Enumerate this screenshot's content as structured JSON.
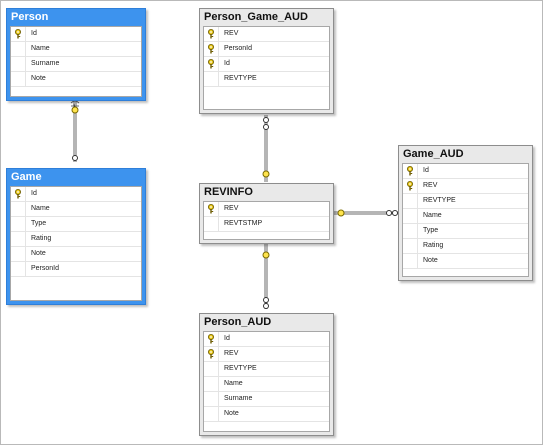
{
  "tables": {
    "person": {
      "title": "Person",
      "columns": [
        {
          "name": "Id",
          "key": true
        },
        {
          "name": "Name",
          "key": false
        },
        {
          "name": "Surname",
          "key": false
        },
        {
          "name": "Note",
          "key": false
        }
      ]
    },
    "game": {
      "title": "Game",
      "columns": [
        {
          "name": "Id",
          "key": true
        },
        {
          "name": "Name",
          "key": false
        },
        {
          "name": "Type",
          "key": false
        },
        {
          "name": "Rating",
          "key": false
        },
        {
          "name": "Note",
          "key": false
        },
        {
          "name": "PersonId",
          "key": false
        }
      ]
    },
    "person_game_aud": {
      "title": "Person_Game_AUD",
      "columns": [
        {
          "name": "REV",
          "key": true
        },
        {
          "name": "PersonId",
          "key": true
        },
        {
          "name": "Id",
          "key": true
        },
        {
          "name": "REVTYPE",
          "key": false
        }
      ]
    },
    "revinfo": {
      "title": "REVINFO",
      "columns": [
        {
          "name": "REV",
          "key": true
        },
        {
          "name": "REVTSTMP",
          "key": false
        }
      ]
    },
    "game_aud": {
      "title": "Game_AUD",
      "columns": [
        {
          "name": "Id",
          "key": true
        },
        {
          "name": "REV",
          "key": true
        },
        {
          "name": "REVTYPE",
          "key": false
        },
        {
          "name": "Name",
          "key": false
        },
        {
          "name": "Type",
          "key": false
        },
        {
          "name": "Rating",
          "key": false
        },
        {
          "name": "Note",
          "key": false
        }
      ]
    },
    "person_aud": {
      "title": "Person_AUD",
      "columns": [
        {
          "name": "Id",
          "key": true
        },
        {
          "name": "REV",
          "key": true
        },
        {
          "name": "REVTYPE",
          "key": false
        },
        {
          "name": "Name",
          "key": false
        },
        {
          "name": "Surname",
          "key": false
        },
        {
          "name": "Note",
          "key": false
        }
      ]
    }
  },
  "colors": {
    "selected_header": "#3d93ee",
    "key_icon": "#e6c619",
    "connector": "#6b6b6b"
  }
}
